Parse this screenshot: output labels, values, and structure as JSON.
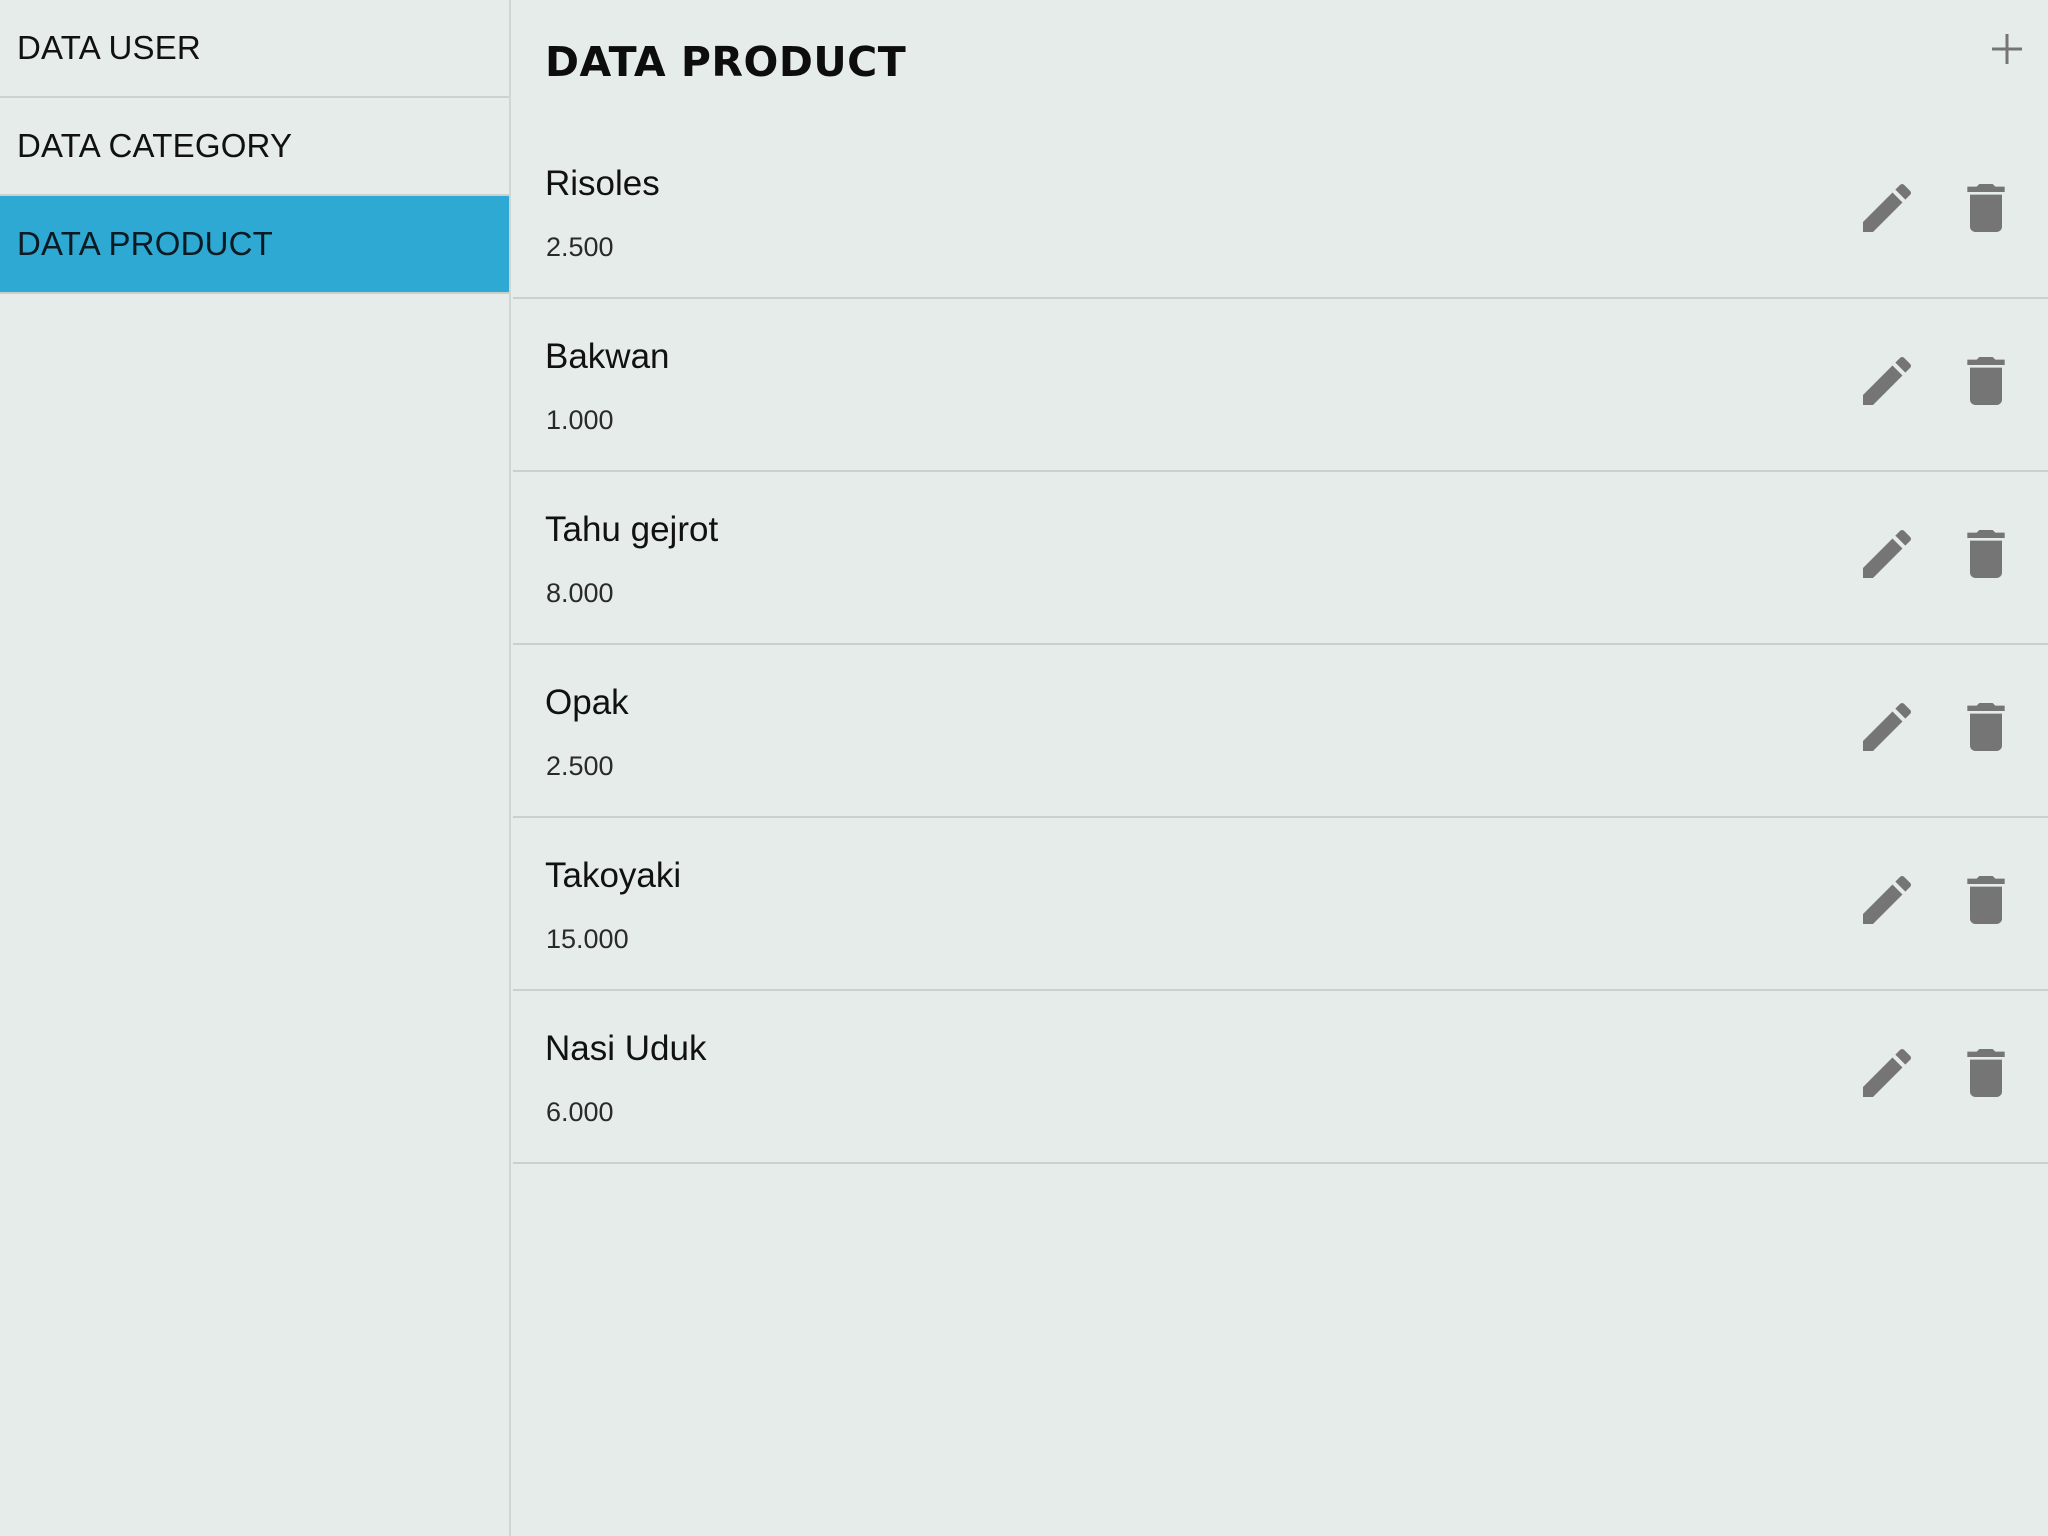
{
  "sidebar": {
    "items": [
      {
        "label": "DATA USER",
        "active": false
      },
      {
        "label": "DATA CATEGORY",
        "active": false
      },
      {
        "label": "DATA PRODUCT",
        "active": true
      }
    ],
    "active_color": "#2ea9d3"
  },
  "header": {
    "title": "DATA PRODUCT",
    "add_icon": "plus-icon"
  },
  "products": [
    {
      "name": "Risoles",
      "price": "2.500"
    },
    {
      "name": "Bakwan",
      "price": "1.000"
    },
    {
      "name": "Tahu gejrot",
      "price": "8.000"
    },
    {
      "name": "Opak",
      "price": "2.500"
    },
    {
      "name": "Takoyaki",
      "price": "15.000"
    },
    {
      "name": "Nasi Uduk",
      "price": "6.000"
    }
  ],
  "row_icons": {
    "edit": "pencil-icon",
    "delete": "trash-icon"
  },
  "colors": {
    "background": "#e6ecea",
    "icon": "#757575"
  }
}
